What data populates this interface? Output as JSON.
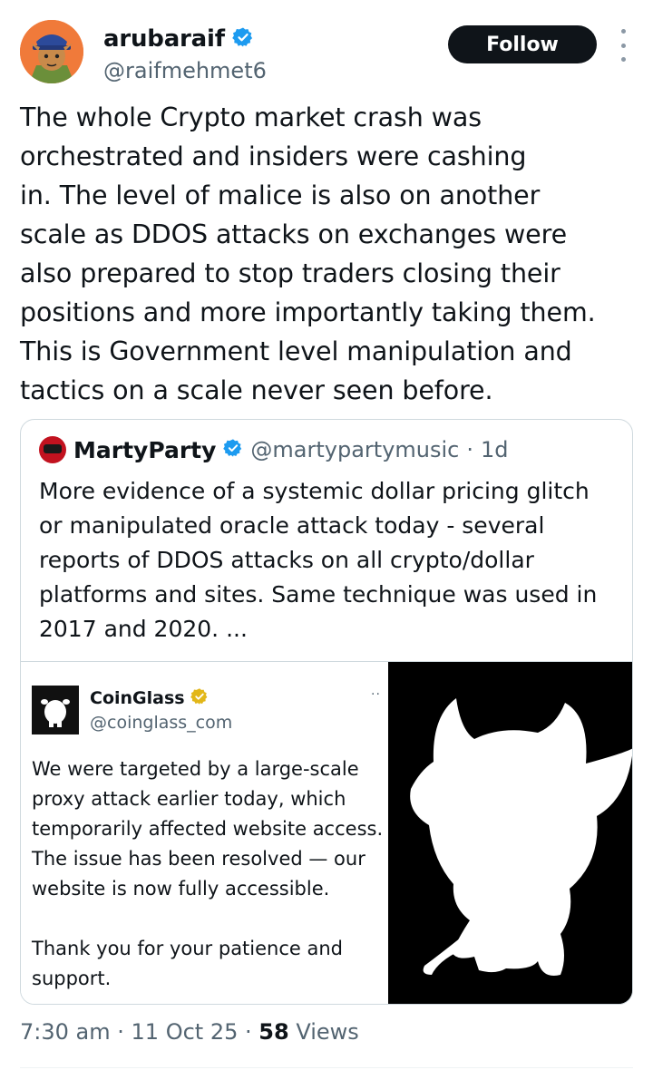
{
  "tweet": {
    "author": {
      "display_name": "arubaraif",
      "handle": "@raifmehmet6",
      "verified_icon": "verified-badge-icon",
      "avatar_icon": "cartoon-avatar"
    },
    "follow_label": "Follow",
    "more_icon": "more-vertical-icon",
    "text": "The whole Crypto market crash was\norchestrated and insiders were cashing\nin. The level of malice is also on another\nscale as DDOS attacks on exchanges were\nalso prepared to stop traders closing their\npositions and more importantly taking them.\nThis is Government level manipulation and\ntactics on a scale never seen before.",
    "time": "7:30 am",
    "date": "11 Oct 25",
    "views_count": "58",
    "views_label": "Views",
    "separator": "·"
  },
  "quoted_tweet": {
    "display_name": "MartyParty",
    "handle": "@martypartymusic",
    "separator": "·",
    "age": "1d",
    "text": "More evidence of a systemic dollar pricing glitch\nor manipulated oracle attack today - several\nreports of DDOS attacks on all crypto/dollar\nplatforms and sites. Same technique was used in\n2017 and 2020. ...",
    "media": {
      "embedded_post": {
        "display_name": "CoinGlass",
        "handle": "@coinglass_com",
        "dots": "··",
        "text": "We were targeted by a large-scale\nproxy attack earlier today, which\ntemporarily affected website access.\nThe issue has been resolved — our\nwebsite is now fully accessible.\n\nThank you for your patience and\nsupport."
      }
    }
  },
  "colors": {
    "text_primary": "#0f1419",
    "text_secondary": "#536471",
    "verified_blue": "#1d9bf0",
    "verified_gold": "#e2b719",
    "border": "#cfd9de",
    "button_bg": "#0f1419"
  }
}
